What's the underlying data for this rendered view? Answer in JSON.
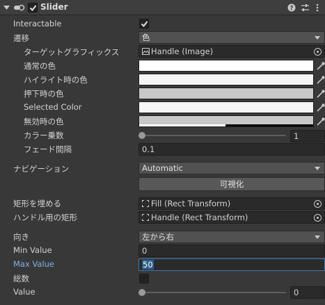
{
  "header": {
    "title": "Slider",
    "enabled": true,
    "icons": [
      "foldout-arrow-icon",
      "script-toggle-icon",
      "help-icon",
      "presets-icon",
      "more-icon"
    ]
  },
  "rows": {
    "interactable": {
      "label": "Interactable",
      "checked": true
    },
    "transition": {
      "label": "遷移",
      "value": "色"
    },
    "target_graphic": {
      "label": "ターゲットグラフィックス",
      "value": "Handle (Image)"
    },
    "normal_color": {
      "label": "通常の色",
      "color": "#ffffff"
    },
    "highlighted_color": {
      "label": "ハイライト時の色",
      "color": "#f5f5f5"
    },
    "pressed_color": {
      "label": "押下時の色",
      "color": "#c8c8c8"
    },
    "selected_color": {
      "label": "Selected Color",
      "color": "#f5f5f5"
    },
    "disabled_color": {
      "label": "無効時の色",
      "color": "#c8c8c8",
      "alpha": 0.5
    },
    "color_multiplier": {
      "label": "カラー乗数",
      "value": "1",
      "fraction": 0
    },
    "fade_duration": {
      "label": "フェード間隔",
      "value": "0.1"
    },
    "navigation": {
      "label": "ナビゲーション",
      "value": "Automatic"
    },
    "visualize": {
      "label": "可視化"
    },
    "fill_rect": {
      "label": "矩形を埋める",
      "value": "Fill (Rect Transform)"
    },
    "handle_rect": {
      "label": "ハンドル用の矩形",
      "value": "Handle (Rect Transform)"
    },
    "direction": {
      "label": "向き",
      "value": "左から右"
    },
    "min_value": {
      "label": "Min Value",
      "value": "0"
    },
    "max_value": {
      "label": "Max Value",
      "value": "50"
    },
    "whole_numbers": {
      "label": "総数",
      "checked": false
    },
    "value": {
      "label": "Value",
      "value": "0",
      "fraction": 0
    }
  },
  "colors": {
    "background": "#383838",
    "field": "#2a2a2a",
    "accent": "#3a79bb",
    "label_focused": "#7fb0e6"
  }
}
